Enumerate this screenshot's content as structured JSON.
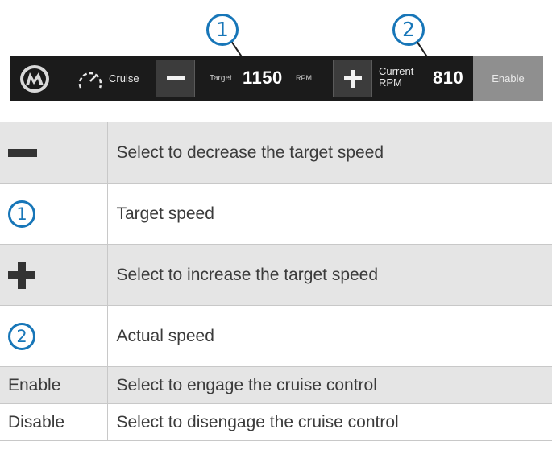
{
  "callouts": {
    "one": "1",
    "two": "2"
  },
  "toolbar": {
    "logo_icon": "mercury-logo-icon",
    "gauge_icon": "speedometer-icon",
    "mode_label": "Cruise",
    "minus_icon": "minus-icon",
    "target_label": "Target",
    "target_value": "1150",
    "unit_label": "RPM",
    "plus_icon": "plus-icon",
    "current_label_1": "Current",
    "current_label_2": "RPM",
    "current_value": "810",
    "enable_label": "Enable"
  },
  "legend": {
    "rows": [
      {
        "key": "minus-icon",
        "desc": "Select to decrease the target speed"
      },
      {
        "key": "1",
        "desc": "Target speed"
      },
      {
        "key": "plus-icon",
        "desc": "Select to increase the target speed"
      },
      {
        "key": "2",
        "desc": "Actual speed"
      },
      {
        "key": "Enable",
        "desc": "Select to engage the cruise control"
      },
      {
        "key": "Disable",
        "desc": "Select to disengage the cruise control"
      }
    ]
  },
  "colors": {
    "callout": "#1776b8",
    "toolbar_bg": "#1b1b1b",
    "enable_button_bg": "#8f8f8f",
    "row_shade": "#e5e5e5"
  }
}
